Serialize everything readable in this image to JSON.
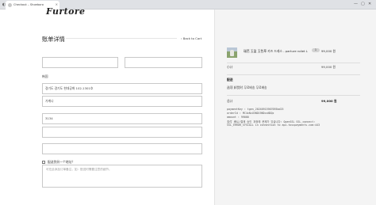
{
  "browser": {
    "tab_title": "Checkout – Shoeboro",
    "close_glyph": "×",
    "controls": [
      "—",
      "▢",
      "✕"
    ]
  },
  "brand": {
    "logo_text": "Furtore"
  },
  "billing": {
    "title": "账单详情",
    "back_link": "‹ Back to Cart",
    "first_name": "",
    "last_name": "",
    "region_label": "韩国",
    "address_1": "경기도 경기도 현대공화 102-1301호",
    "address_2": "가계나",
    "postcode": "3134",
    "phone": "",
    "email": "",
    "ship_different_label": "配送到另一个地址？",
    "notes_placeholder": "可在此添加订单备注，如：配送时需要注意的细节。"
  },
  "order": {
    "product_name": "瑞芭 玉盈 玉色草 카즈 드레스 - parture roliet L",
    "quantity": "1",
    "product_price": "99,000 원",
    "subtotal_label": "小计",
    "subtotal_value": "99,000 원",
    "shipping_label": "配送",
    "shipping_value": "选项 卸货时 무료배송 무료배송",
    "total_label": "总计",
    "total_value": "99,000 원",
    "debug_lines": [
      "paymentKey : tgen_20240915907095bd25",
      "orderId : MC4xNzU3ND19NDcxNDQz",
      "amount : 99000",
      "支付 承认/결제 승인 과정에 문제가 있습니다: OpenSSL SSL_connect:",
      "SSL_ERROR_SYSCALL in connection to api.tosspayments.com:443"
    ]
  }
}
